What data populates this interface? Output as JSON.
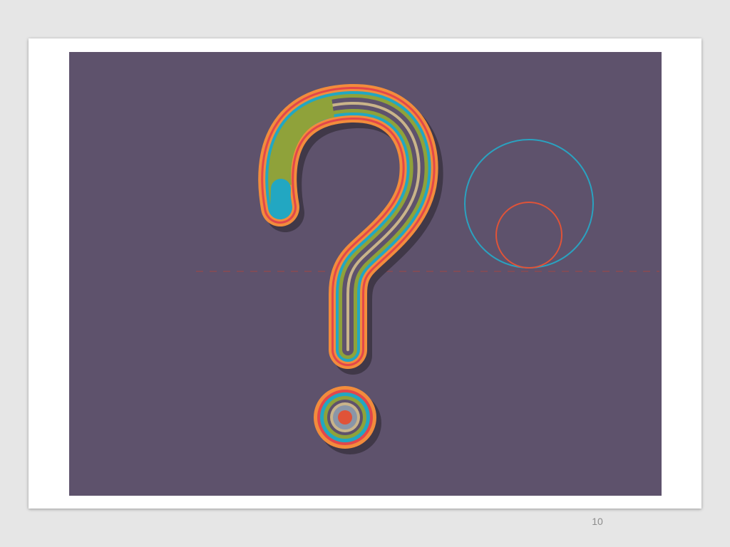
{
  "slide": {
    "page_number": "10"
  },
  "artwork": {
    "subject": "question-mark",
    "colors": {
      "background": "#5e526c",
      "outer_ring": "#f28c3c",
      "red_ring": "#e2474b",
      "teal_ring": "#22a7c2",
      "green_ring": "#8fa23a",
      "beige_ring": "#c9b48a",
      "shadow": "#3b3442",
      "circle_large": "#2aa2c0",
      "circle_small": "#e05338",
      "dashed_line": "#8a4a52"
    }
  }
}
